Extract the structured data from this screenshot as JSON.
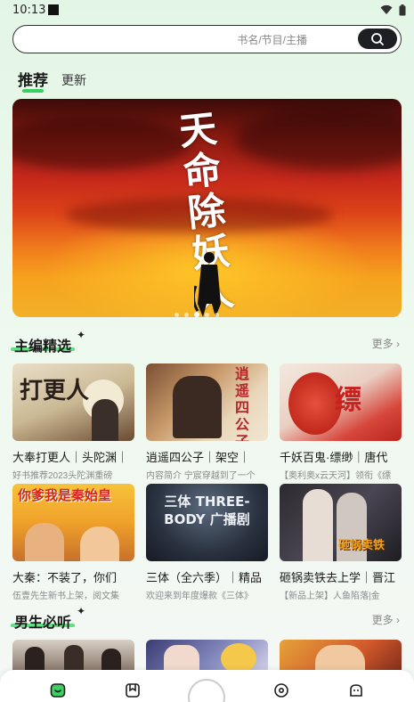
{
  "status_bar": {
    "time": "10:13"
  },
  "search": {
    "placeholder": "书名/节目/主播"
  },
  "tabs": [
    {
      "label": "推荐",
      "active": true
    },
    {
      "label": "更新",
      "active": false
    }
  ],
  "banner": {
    "calligraphy": "天命除妖人",
    "page_count": 5,
    "active_index": 2
  },
  "sections": [
    {
      "title": "主编精选",
      "more": "更多",
      "items": [
        {
          "title": "大奉打更人｜头陀渊｜",
          "desc": "好书推荐2023头陀渊重磅",
          "cover_text": "打更人"
        },
        {
          "title": "逍遥四公子｜架空｜",
          "desc": "内容简介 宁宸穿越到了一个",
          "cover_text": "逍遥四公子"
        },
        {
          "title": "千妖百鬼·缥缈｜唐代",
          "desc": "【奥利奥x云天河】领衔《缥",
          "cover_text": "缥"
        },
        {
          "title": "大秦：不装了，你们",
          "desc": "伍壹先生新书上架，阅文集",
          "cover_text": "你爹我是秦始皇"
        },
        {
          "title": "三体（全六季）｜精品",
          "desc": "欢迎来到年度爆款《三体》",
          "cover_text": "三体 THREE-BODY 广播剧"
        },
        {
          "title": "砸锅卖铁去上学｜晋江",
          "desc": "【新品上架】人鱼陷落|金",
          "cover_text": "砸锅卖铁"
        }
      ]
    },
    {
      "title": "男生必听",
      "more": "更多",
      "items": []
    }
  ],
  "colors": {
    "accent": "#3ccf62",
    "background": "#e7f7ea"
  }
}
